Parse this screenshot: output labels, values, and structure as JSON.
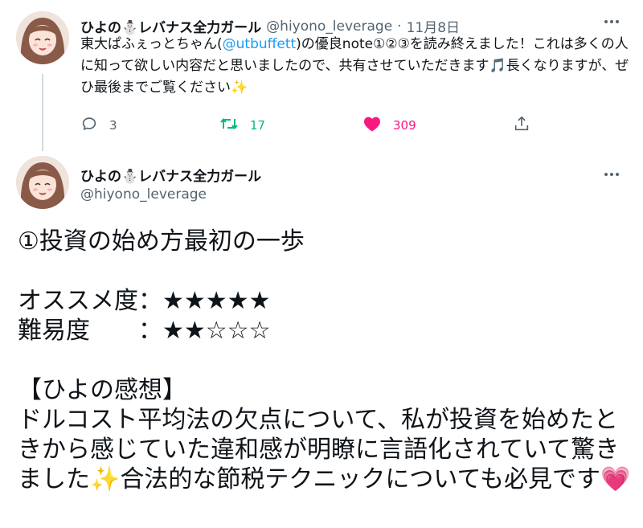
{
  "tweet1": {
    "author_name": "ひよの⛄レバナス全力ガール",
    "handle": "@hiyono_leverage",
    "separator": "·",
    "date": "11月8日",
    "text_before_mention": "東大ぱふぇっとちゃん(",
    "mention": "@utbuffett",
    "text_after_mention": ")の優良note①②③を読み終えました！これは多くの人に知って欲しい内容だと思いましたので、共有させていただきます🎵長くなりますが、ぜひ最後までご覧ください✨",
    "reply_count": "3",
    "retweet_count": "17",
    "like_count": "309",
    "icons": {
      "reply": "reply-icon",
      "retweet": "retweet-icon",
      "like": "heart-icon",
      "share": "share-icon",
      "more": "more-icon"
    },
    "colors": {
      "retweet": "#00ba7c",
      "like": "#f91880",
      "mention": "#1d9bf0",
      "secondary_text": "#536471"
    }
  },
  "tweet2": {
    "author_name": "ひよの⛄レバナス全力ガール",
    "handle": "@hiyono_leverage",
    "text": "①投資の始め方最初の一歩\n\nオススメ度：★★★★★\n難易度　　：★★☆☆☆\n\n【ひよの感想】\nドルコスト平均法の欠点について、私が投資を始めたときから感じていた違和感が明瞭に言語化されていて驚きました✨合法的な節税テクニックについても必見です💗"
  }
}
